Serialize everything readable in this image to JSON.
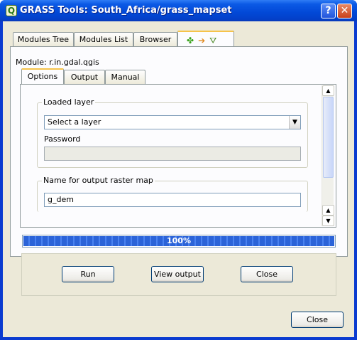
{
  "window": {
    "title": "GRASS Tools: South_Africa/grass_mapset",
    "help_label": "?",
    "close_label": "✕"
  },
  "tabs": [
    {
      "label": "Modules Tree"
    },
    {
      "label": "Modules List"
    },
    {
      "label": "Browser"
    }
  ],
  "module": {
    "label": "Module: r.in.gdal.qgis"
  },
  "subtabs": [
    {
      "label": "Options"
    },
    {
      "label": "Output"
    },
    {
      "label": "Manual"
    }
  ],
  "loaded_layer": {
    "title": "Loaded layer",
    "select_value": "Select a layer",
    "password_label": "Password",
    "password_value": ""
  },
  "output_map": {
    "title": "Name for output raster map",
    "value": "g_dem"
  },
  "progress": {
    "text": "100%",
    "value": 1.0
  },
  "actions": {
    "run_label": "Run",
    "view_output_label": "View output",
    "close_label": "Close"
  },
  "footer": {
    "close_label": "Close"
  },
  "icons": [
    "app-icon",
    "module-icon",
    "arrow-icon",
    "qgis-icon"
  ]
}
